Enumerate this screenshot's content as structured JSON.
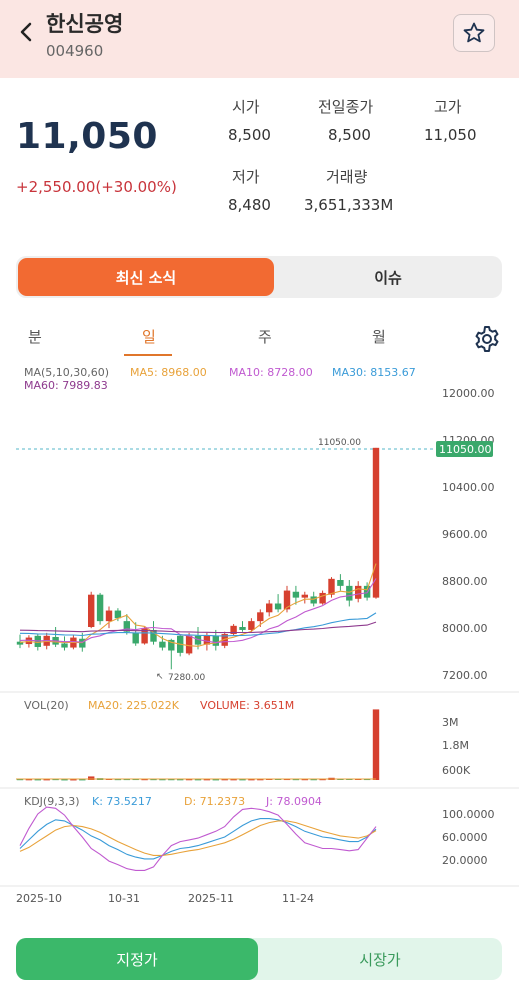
{
  "header": {
    "name": "한신공영",
    "code": "004960"
  },
  "price": {
    "current": "11,050",
    "change": "+2,550.00(+30.00%)"
  },
  "stats": [
    {
      "label": "시가",
      "value": "8,500"
    },
    {
      "label": "전일종가",
      "value": "8,500"
    },
    {
      "label": "고가",
      "value": "11,050"
    },
    {
      "label": "저가",
      "value": "8,480"
    },
    {
      "label": "거래량",
      "value": "3,651,333M"
    }
  ],
  "tabs": [
    "최신 소식",
    "이슈"
  ],
  "periods": [
    "분",
    "일",
    "주",
    "월"
  ],
  "active_period": "일",
  "colors": {
    "up": "#d6402f",
    "down": "#3aa86b",
    "accent": "#f26a32",
    "ma5": "#e8a23a",
    "ma10": "#c05ad0",
    "ma30": "#3a9bd8",
    "ma60": "#8e3a8e"
  },
  "chart_data": [
    {
      "type": "candlestick",
      "legend": {
        "ma_params": "MA(5,10,30,60)",
        "ma5": "MA5: 8968.00",
        "ma10": "MA10: 8728.00",
        "ma30": "MA30: 8153.67",
        "ma60": "MA60: 7989.83"
      },
      "y_ticks": [
        "12000.00",
        "11200.00",
        "10400.00",
        "9600.00",
        "8800.00",
        "8000.00",
        "7200.00"
      ],
      "ylim": [
        7000,
        12400
      ],
      "last_price_label": "11050.00",
      "max_label": "11050.00",
      "min_label": "7280.00",
      "x_labels": [
        "2025-10",
        "10-31",
        "2025-11",
        "11-24"
      ],
      "candles": [
        [
          7750,
          7870,
          7640,
          7700
        ],
        [
          7710,
          7860,
          7650,
          7820
        ],
        [
          7850,
          7880,
          7600,
          7660
        ],
        [
          7680,
          7900,
          7620,
          7850
        ],
        [
          7830,
          8000,
          7660,
          7700
        ],
        [
          7720,
          7840,
          7600,
          7650
        ],
        [
          7650,
          7870,
          7620,
          7820
        ],
        [
          7800,
          7900,
          7580,
          7650
        ],
        [
          8000,
          8600,
          7980,
          8550
        ],
        [
          8550,
          8580,
          8040,
          8100
        ],
        [
          8100,
          8350,
          7980,
          8280
        ],
        [
          8280,
          8320,
          8100,
          8150
        ],
        [
          8100,
          8220,
          7870,
          7920
        ],
        [
          7900,
          8080,
          7680,
          7720
        ],
        [
          7720,
          8000,
          7700,
          7980
        ],
        [
          7950,
          8100,
          7700,
          7750
        ],
        [
          7750,
          7850,
          7600,
          7650
        ],
        [
          7780,
          7800,
          7280,
          7600
        ],
        [
          7850,
          7880,
          7500,
          7560
        ],
        [
          7550,
          7900,
          7520,
          7850
        ],
        [
          7850,
          8000,
          7620,
          7700
        ],
        [
          7700,
          7900,
          7600,
          7850
        ],
        [
          7850,
          7950,
          7600,
          7680
        ],
        [
          7680,
          7920,
          7640,
          7880
        ],
        [
          7880,
          8050,
          7850,
          8020
        ],
        [
          8000,
          8100,
          7920,
          7950
        ],
        [
          7950,
          8150,
          7900,
          8100
        ],
        [
          8100,
          8300,
          8000,
          8250
        ],
        [
          8250,
          8460,
          8180,
          8400
        ],
        [
          8400,
          8560,
          8250,
          8300
        ],
        [
          8300,
          8700,
          8250,
          8620
        ],
        [
          8600,
          8700,
          8380,
          8500
        ],
        [
          8500,
          8600,
          8400,
          8550
        ],
        [
          8520,
          8600,
          8350,
          8400
        ],
        [
          8400,
          8620,
          8380,
          8580
        ],
        [
          8550,
          8850,
          8500,
          8820
        ],
        [
          8800,
          8900,
          8620,
          8700
        ],
        [
          8700,
          8800,
          8350,
          8450
        ],
        [
          8480,
          8780,
          8420,
          8700
        ],
        [
          8700,
          8760,
          8450,
          8500
        ],
        [
          8500,
          11050,
          8480,
          11050
        ]
      ]
    },
    {
      "type": "bar",
      "legend": {
        "params": "VOL(20)",
        "ma20": "MA20: 225.022K",
        "volume": "VOLUME: 3.651M"
      },
      "y_ticks": [
        "3M",
        "1.8M",
        "600K"
      ],
      "ylim": [
        0,
        4000000
      ],
      "values": [
        41000,
        36000,
        32000,
        33000,
        44000,
        30000,
        29000,
        31000,
        185000,
        96000,
        52000,
        44000,
        47000,
        49000,
        41000,
        43000,
        38000,
        40000,
        36000,
        38000,
        34000,
        35000,
        32000,
        36000,
        35000,
        33000,
        34000,
        37000,
        60000,
        54000,
        49000,
        43000,
        40000,
        39000,
        41000,
        115000,
        72000,
        66000,
        55000,
        49000,
        3651333
      ]
    },
    {
      "type": "line",
      "legend": {
        "params": "KDJ(9,3,3)",
        "k": "K: 73.5217",
        "d": "D: 71.2373",
        "j": "J: 78.0904"
      },
      "y_ticks": [
        "100.0000",
        "60.0000",
        "20.0000"
      ],
      "ylim": [
        0,
        120
      ],
      "series": [
        {
          "name": "K",
          "values": [
            40,
            55,
            70,
            82,
            90,
            88,
            80,
            72,
            62,
            55,
            45,
            38,
            30,
            25,
            22,
            22,
            28,
            35,
            40,
            42,
            45,
            50,
            55,
            60,
            70,
            80,
            88,
            92,
            92,
            90,
            85,
            78,
            70,
            65,
            60,
            58,
            55,
            52,
            52,
            60,
            73.5
          ]
        },
        {
          "name": "D",
          "values": [
            35,
            42,
            52,
            62,
            72,
            78,
            80,
            78,
            74,
            68,
            60,
            52,
            45,
            38,
            32,
            28,
            28,
            30,
            33,
            36,
            38,
            42,
            46,
            50,
            56,
            64,
            72,
            80,
            85,
            88,
            88,
            85,
            80,
            75,
            70,
            66,
            62,
            60,
            58,
            62,
            71.2
          ]
        },
        {
          "name": "J",
          "values": [
            45,
            75,
            100,
            112,
            110,
            98,
            78,
            60,
            40,
            30,
            18,
            12,
            5,
            2,
            2,
            8,
            28,
            45,
            52,
            55,
            58,
            64,
            70,
            78,
            95,
            108,
            110,
            108,
            104,
            98,
            82,
            65,
            50,
            45,
            40,
            40,
            38,
            36,
            38,
            58,
            78.1
          ]
        }
      ]
    }
  ],
  "order": {
    "limit": "지정가",
    "market": "시장가"
  }
}
